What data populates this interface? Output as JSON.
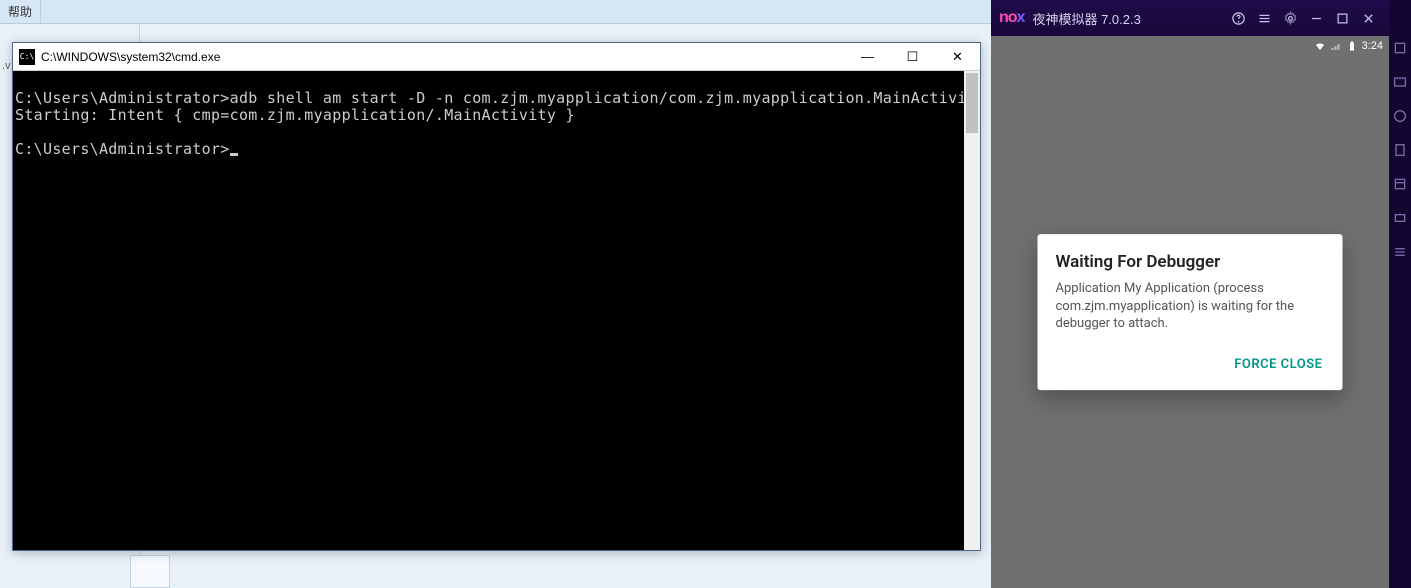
{
  "background": {
    "help_tab": "帮助",
    "v_fragment": ".v"
  },
  "cmd": {
    "title": "C:\\WINDOWS\\system32\\cmd.exe",
    "icon_glyph": "C:\\",
    "lines": {
      "l1_prompt": "C:\\Users\\Administrator>",
      "l1_cmd": "adb shell am start -D -n com.zjm.myapplication/com.zjm.myapplication.MainActivity",
      "l2": "Starting: Intent { cmp=com.zjm.myapplication/.MainActivity }",
      "l3_prompt": "C:\\Users\\Administrator>"
    },
    "controls": {
      "min": "—",
      "max": "☐",
      "close": "✕"
    }
  },
  "nox": {
    "logo_a": "no",
    "logo_b": "x",
    "title": "夜神模拟器 7.0.2.3",
    "titlebar_icons": {
      "help": "help-icon",
      "menu": "menu-icon",
      "settings": "gear-icon",
      "min": "minimize-icon",
      "max": "maximize-icon",
      "close": "close-icon"
    },
    "status": {
      "time": "3:24"
    },
    "dialog": {
      "title": "Waiting For Debugger",
      "body": "Application My Application (process com.zjm.myapplication) is waiting for the debugger to attach.",
      "action": "FORCE CLOSE"
    },
    "sidebar_icons": [
      "tool-1",
      "tool-2",
      "tool-3",
      "tool-4",
      "tool-5",
      "tool-6",
      "tool-7"
    ]
  }
}
